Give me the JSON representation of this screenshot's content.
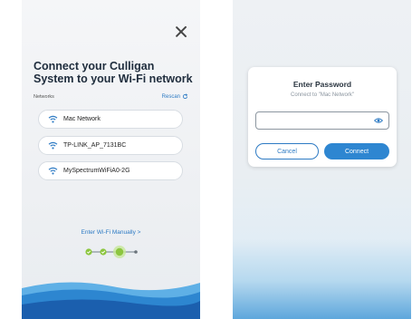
{
  "left_screen": {
    "title": "Connect your Culligan System to your Wi-Fi network",
    "networks_label": "Networks",
    "rescan_label": "Rescan",
    "networks": [
      {
        "name": "Mac Network"
      },
      {
        "name": "TP-LINK_AP_7131BC"
      },
      {
        "name": "MySpectrumWiFiA0-2G"
      }
    ],
    "manual_link": "Enter Wi-Fi Manually >",
    "steps_total": 4,
    "steps_completed": 2,
    "current_step": 3,
    "icons": {
      "close": "close-icon",
      "rescan": "refresh-icon",
      "network": "wifi-icon"
    }
  },
  "right_screen": {
    "dialog": {
      "title": "Enter Password",
      "subtitle": "Connect to \"Mac Network\"",
      "password_value": "",
      "cancel_label": "Cancel",
      "connect_label": "Connect",
      "icons": {
        "toggle_visibility": "eye-icon"
      }
    }
  },
  "colors": {
    "accent": "#2e7bc4",
    "progress_green": "#8cc63f",
    "wave_dark": "#1b6fc2",
    "wave_light": "#5fb0e6"
  }
}
